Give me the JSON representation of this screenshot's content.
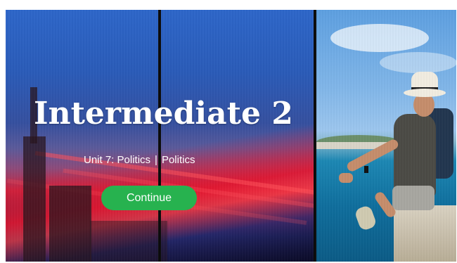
{
  "hero": {
    "title": "Intermediate 2",
    "unit": "Unit 7: Politics",
    "separator": "|",
    "topic": "Politics"
  },
  "actions": {
    "continue_label": "Continue"
  },
  "colors": {
    "continue_button": "#27b24f",
    "text": "#ffffff",
    "panel_divider": "#0b0b0b"
  }
}
